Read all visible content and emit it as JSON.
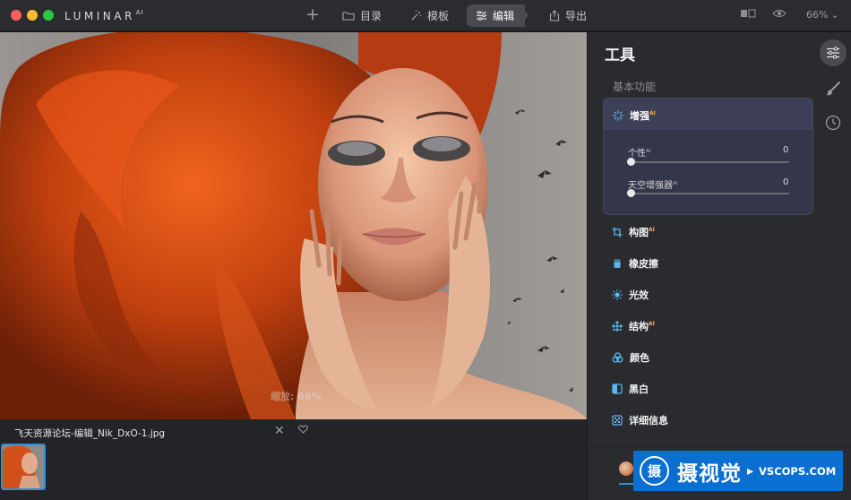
{
  "titlebar": {
    "brand": "LUMINAR",
    "brand_suffix": "AI",
    "nav": {
      "catalog": "目录",
      "template": "模板",
      "edit": "编辑",
      "export": "导出"
    },
    "zoom": "66%"
  },
  "canvas": {
    "zoom_overlay": "缩放: 66%"
  },
  "filmstrip": {
    "filename": "飞天资源论坛-编辑_Nik_DxO-1.jpg"
  },
  "panel": {
    "title": "工具",
    "section_label": "基本功能",
    "enhance": {
      "label": "增强",
      "ai_badge": "AI",
      "sliders": [
        {
          "label": "个性",
          "ai": "AI",
          "value": "0",
          "level": 0
        },
        {
          "label": "天空增强器",
          "ai": "AI",
          "value": "0",
          "level": 0
        }
      ]
    },
    "tools": [
      {
        "label": "构图",
        "ai": "AI",
        "icon": "crop-icon"
      },
      {
        "label": "橡皮擦",
        "ai": "",
        "icon": "eraser-icon"
      },
      {
        "label": "光效",
        "ai": "",
        "icon": "sun-icon"
      },
      {
        "label": "结构",
        "ai": "AI",
        "icon": "structure-icon"
      },
      {
        "label": "颜色",
        "ai": "",
        "icon": "color-icon"
      },
      {
        "label": "黑白",
        "ai": "",
        "icon": "bw-icon"
      },
      {
        "label": "详细信息",
        "ai": "",
        "icon": "details-icon"
      }
    ]
  },
  "watermark": {
    "seal": "摄",
    "main": "摄视觉",
    "sub": "VSCOPS.COM"
  },
  "colors": {
    "accent": "#2d8fd6",
    "ai_badge": "#f0b24c",
    "panel_bg": "#2a2b2f",
    "enhance_card": "#34364a"
  }
}
